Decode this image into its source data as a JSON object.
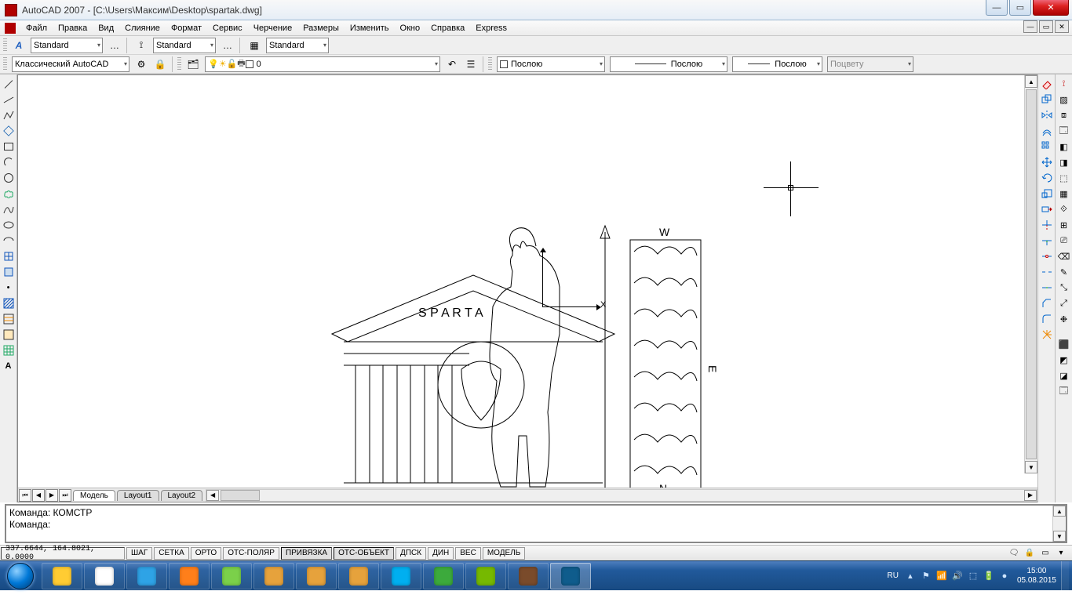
{
  "title": "AutoCAD 2007 - [C:\\Users\\Максим\\Desktop\\spartak.dwg]",
  "menu": [
    "Файл",
    "Правка",
    "Вид",
    "Слияние",
    "Формат",
    "Сервис",
    "Черчение",
    "Размеры",
    "Изменить",
    "Окно",
    "Справка",
    "Express"
  ],
  "styles": {
    "textStyle": "Standard",
    "dimStyle": "Standard",
    "tableStyle": "Standard",
    "workspace": "Классический AutoCAD"
  },
  "layer": {
    "current": "0",
    "color": "#ffffff"
  },
  "properties": {
    "colorByLayer": "Послою",
    "linetypeByLayer": "Послою",
    "lineweightByLayer": "Послою",
    "plotstyle": "Поцвету"
  },
  "tabs": {
    "model": "Модель",
    "layouts": [
      "Layout1",
      "Layout2"
    ]
  },
  "command": {
    "line1": "Команда: КОМСТР",
    "line2": "Команда:"
  },
  "status": {
    "coords": "337.6644, 164.8021, 0.0000",
    "toggles": [
      {
        "label": "ШАГ",
        "on": false
      },
      {
        "label": "СЕТКА",
        "on": false
      },
      {
        "label": "ОРТО",
        "on": false
      },
      {
        "label": "ОТС-ПОЛЯР",
        "on": false
      },
      {
        "label": "ПРИВЯЗКА",
        "on": true
      },
      {
        "label": "ОТС-ОБЪЕКТ",
        "on": true
      },
      {
        "label": "ДПСК",
        "on": false
      },
      {
        "label": "ДИН",
        "on": false
      },
      {
        "label": "ВЕС",
        "on": false
      },
      {
        "label": "МОДЕЛЬ",
        "on": false
      }
    ]
  },
  "ucs": {
    "xLabel": "X"
  },
  "tray": {
    "lang": "RU",
    "time": "15:00",
    "date": "05.08.2015"
  },
  "leftTools": [
    "line",
    "ray",
    "polyline",
    "polygon",
    "rectangle",
    "arc",
    "circle",
    "cloud",
    "spline",
    "ellipse",
    "ellipse-arc",
    "block",
    "point",
    "hatch",
    "region",
    "table",
    "text"
  ],
  "rightTools": [
    "erase",
    "copy",
    "mirror",
    "offset",
    "array",
    "move",
    "rotate",
    "scale",
    "stretch",
    "trim",
    "extend",
    "break",
    "break2",
    "join",
    "chamfer",
    "fillet",
    "explode"
  ],
  "taskbarApps": [
    {
      "name": "explorer",
      "color": "#ffcc33"
    },
    {
      "name": "chrome",
      "color": "#ffffff"
    },
    {
      "name": "ie",
      "color": "#2ea3e6"
    },
    {
      "name": "wmp",
      "color": "#ff7f1a"
    },
    {
      "name": "msn",
      "color": "#7bd04a"
    },
    {
      "name": "folder1",
      "color": "#e6a23c"
    },
    {
      "name": "folder2",
      "color": "#e6a23c"
    },
    {
      "name": "folder3",
      "color": "#e6a23c"
    },
    {
      "name": "skype",
      "color": "#00aff0"
    },
    {
      "name": "utorrent",
      "color": "#3caa3c"
    },
    {
      "name": "nvidia",
      "color": "#76b900"
    },
    {
      "name": "winrar",
      "color": "#7a4b2b"
    },
    {
      "name": "autocad",
      "color": "#0f5c8c",
      "active": true
    }
  ]
}
